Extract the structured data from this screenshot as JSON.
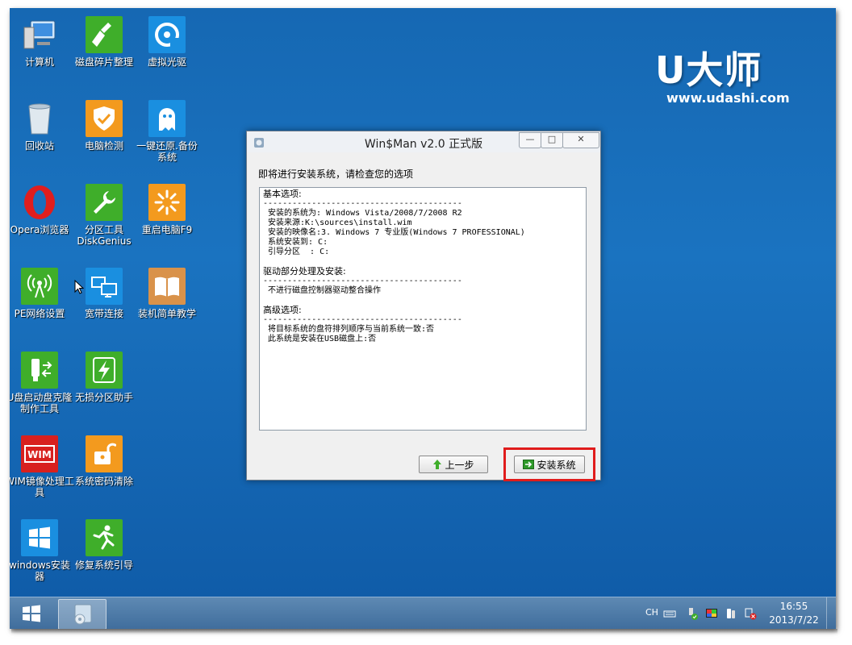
{
  "desktop": {
    "icons": [
      {
        "label": "计算机",
        "icon": "computer-icon"
      },
      {
        "label": "磁盘碎片整理",
        "icon": "broom-icon"
      },
      {
        "label": "虚拟光驱",
        "icon": "disc-icon"
      },
      {
        "label": "回收站",
        "icon": "recycle-bin-icon"
      },
      {
        "label": "电脑检测",
        "icon": "shield-check-icon"
      },
      {
        "label": "一键还原.备份系统",
        "icon": "ghost-icon"
      },
      {
        "label": "Opera浏览器",
        "icon": "opera-icon"
      },
      {
        "label": "分区工具DiskGenius",
        "icon": "wrench-icon"
      },
      {
        "label": "重启电脑F9",
        "icon": "restart-icon"
      },
      {
        "label": "PE网络设置",
        "icon": "network-icon"
      },
      {
        "label": "宽带连接",
        "icon": "monitors-icon"
      },
      {
        "label": "装机简单教学",
        "icon": "book-icon"
      },
      {
        "label": "U盘启动盘克隆制作工具",
        "icon": "usb-icon"
      },
      {
        "label": "无损分区助手",
        "icon": "lightning-icon"
      },
      {
        "label": "WIM镜像处理工具",
        "icon": "wim-icon"
      },
      {
        "label": "系统密码清除",
        "icon": "padlock-icon"
      },
      {
        "label": "windows安装器",
        "icon": "windows-icon"
      },
      {
        "label": "修复系统引导",
        "icon": "runner-icon"
      }
    ],
    "logo": {
      "mark": "U大师",
      "url": "www.udashi.com"
    }
  },
  "window": {
    "title": "Win$Man v2.0 正式版",
    "instruction": "即将进行安装系统，请检查您的选项",
    "lines": [
      {
        "t": "基本选项:",
        "kind": "h"
      },
      {
        "t": "-----------------------------------------",
        "kind": "l"
      },
      {
        "t": " 安装的系统为: Windows Vista/2008/7/2008 R2",
        "kind": "l"
      },
      {
        "t": " 安装来源:K:\\sources\\install.wim",
        "kind": "l"
      },
      {
        "t": " 安装的映像名:3. Windows 7 专业版(Windows 7 PROFESSIONAL)",
        "kind": "l"
      },
      {
        "t": " 系统安装到: C:",
        "kind": "l"
      },
      {
        "t": " 引导分区  : C:",
        "kind": "l"
      },
      {
        "t": "",
        "kind": "gap"
      },
      {
        "t": "驱动部分处理及安装:",
        "kind": "h"
      },
      {
        "t": "-----------------------------------------",
        "kind": "l"
      },
      {
        "t": " 不进行磁盘控制器驱动整合操作",
        "kind": "l"
      },
      {
        "t": "",
        "kind": "gap"
      },
      {
        "t": "高级选项:",
        "kind": "h"
      },
      {
        "t": "-----------------------------------------",
        "kind": "l"
      },
      {
        "t": " 将目标系统的盘符排列顺序与当前系统一致:否",
        "kind": "l"
      },
      {
        "t": " 此系统是安装在USB磁盘上:否",
        "kind": "l"
      }
    ],
    "back_label": "上一步",
    "install_label": "安装系统",
    "min_glyph": "—",
    "max_glyph": "□",
    "close_glyph": "✕"
  },
  "taskbar": {
    "lang": "CH",
    "time": "16:55",
    "date": "2013/7/22"
  },
  "colors": {
    "desktop": "#1a6fbd",
    "highlight": "#e01c1c",
    "taskbar": "#4a78a6"
  }
}
